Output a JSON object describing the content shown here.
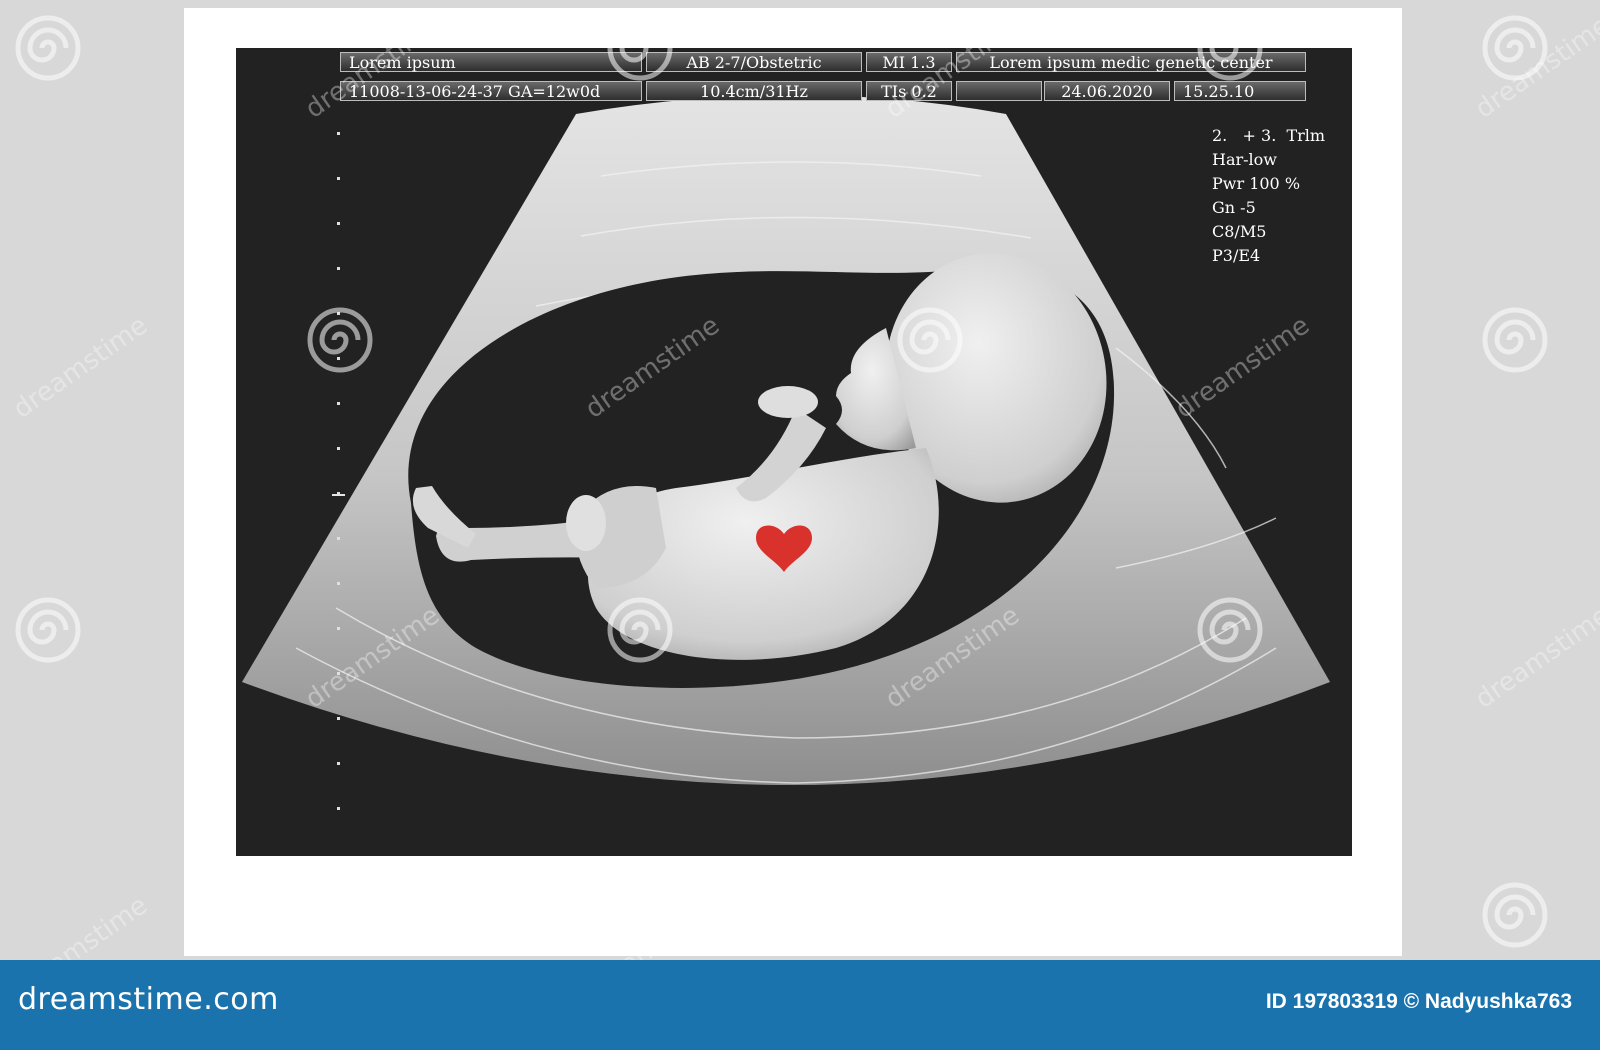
{
  "header": {
    "row1": {
      "patient_label": "Lorem ipsum",
      "probe_preset": "AB 2-7/Obstetric",
      "mi": "MI 1.3",
      "center": "Lorem ipsum medic genetic center"
    },
    "row2": {
      "study_id": "11008-13-06-24-37  GA=12w0d",
      "depth_freq": "10.4cm/31Hz",
      "tis": "TIs 0.2",
      "date": "24.06.2020",
      "time": "15.25.10"
    }
  },
  "params": [
    "2.   + 3.  Trlm",
    "Har-low",
    "Pwr 100 %",
    "Gn -5",
    "C8/M5",
    "P3/E4"
  ],
  "colors": {
    "screen": "#222222",
    "scan_fan": "#c9c9c9",
    "fetus": "#d6d6d6",
    "heart": "#d9312b",
    "footer": "#1a73ac"
  },
  "footer": {
    "logo": "dreamstime.com",
    "id_text": "ID 197803319 © Nadyushka763"
  },
  "watermark": {
    "text": "dreamstime"
  }
}
